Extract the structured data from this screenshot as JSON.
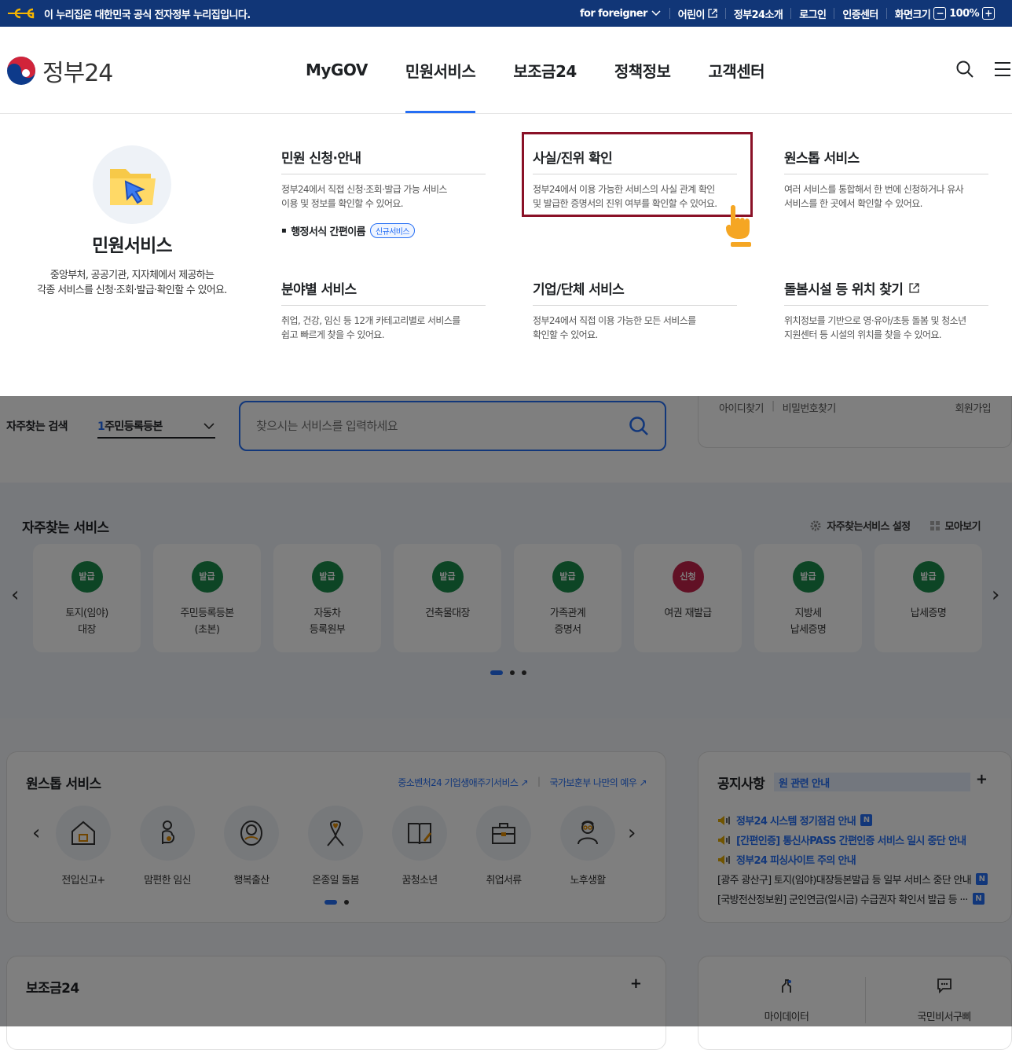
{
  "topbar": {
    "notice": "이 누리집은 대한민국 공식 전자정부 누리집입니다.",
    "links": {
      "foreigner": "for foreigner",
      "kids": "어린이",
      "about": "정부24소개",
      "login": "로그인",
      "cert": "인증센터",
      "screen_size": "화면크기",
      "zoom": "100%"
    }
  },
  "header": {
    "logo_text": "정부24",
    "nav": [
      "MyGOV",
      "민원서비스",
      "보조금24",
      "정책정보",
      "고객센터"
    ],
    "active_nav": "민원서비스"
  },
  "mega": {
    "intro_title": "민원서비스",
    "intro_desc_1": "중앙부처, 공공기관, 지자체에서 제공하는",
    "intro_desc_2": "각종 서비스를 신청·조회·발급·확인할 수 있어요.",
    "col1_title": "민원 신청·안내",
    "col1_desc_1": "정부24에서 직접 신청·조회·발급 가능 서비스",
    "col1_desc_2": "이용 및 정보를 확인할 수 있어요.",
    "col1_sub": "행정서식 간편이름",
    "col1_sub_badge": "신규서비스",
    "col2_title": "사실/진위 확인",
    "col2_desc_1": "정부24에서 이용 가능한 서비스의 사실 관계 확인",
    "col2_desc_2": "및 발급한 증명서의 진위 여부를 확인할 수 있어요.",
    "col3_title": "원스톱 서비스",
    "col3_desc_1": "여러 서비스를 통합해서 한 번에 신청하거나 유사",
    "col3_desc_2": "서비스를 한 곳에서 확인할 수 있어요.",
    "col4_title": "분야별 서비스",
    "col4_desc_1": "취업, 건강, 임신 등 12개 카테고리별로 서비스를",
    "col4_desc_2": "쉽고 빠르게 찾을 수 있어요.",
    "col5_title": "기업/단체 서비스",
    "col5_desc_1": "정부24에서 직접 이용 가능한 모든 서비스를",
    "col5_desc_2": "확인할 수 있어요.",
    "col6_title": "돌봄시설 등 위치 찾기",
    "col6_desc_1": "위치정보를 기반으로 영·유아/초등 돌봄 및 청소년",
    "col6_desc_2": "지원센터 등 시설의 위치를 찾을 수 있어요."
  },
  "search": {
    "label": "자주찾는 검색",
    "select_num": "1",
    "select_value": "주민등록등본",
    "placeholder": "찾으시는 서비스를 입력하세요"
  },
  "login_card": {
    "find_id": "아이디찾기",
    "find_pw": "비밀번호찾기",
    "signup": "회원가입"
  },
  "favorites": {
    "title": "자주찾는 서비스",
    "settings": "자주찾는서비스 설정",
    "view_all": "모아보기",
    "items": [
      {
        "tag": "발급",
        "name": "토지(임야)\n대장"
      },
      {
        "tag": "발급",
        "name": "주민등록등본\n(초본)"
      },
      {
        "tag": "발급",
        "name": "자동차\n등록원부"
      },
      {
        "tag": "발급",
        "name": "건축물대장"
      },
      {
        "tag": "발급",
        "name": "가족관계\n증명서"
      },
      {
        "tag": "신청",
        "name": "여권 재발급"
      },
      {
        "tag": "발급",
        "name": "지방세\n납세증명"
      },
      {
        "tag": "발급",
        "name": "납세증명"
      }
    ]
  },
  "onestop": {
    "title": "원스톱 서비스",
    "link1": "중소벤처24 기업생애주기서비스",
    "link2": "국가보훈부 나만의 예우",
    "items": [
      "전입신고+",
      "맘편한 임신",
      "행복출산",
      "온종일 돌봄",
      "꿈청소년",
      "취업서류",
      "노후생활"
    ]
  },
  "notice": {
    "title": "공지사항",
    "tag": "원 관련 안내",
    "items": [
      "정부24 시스템 정기점검 안내",
      "[간편인증] 통신사PASS 간편인증 서비스 일시 중단 안내",
      "정부24 피싱사이트 주의 안내",
      "[광주 광산구] 토지(임야)대장등본발급 등 일부 서비스 중단 안내",
      "[국방전산정보원] 군인연금(일시금) 수급권자 확인서 발급 등 ···"
    ]
  },
  "subsidy": {
    "title": "보조금24"
  },
  "quick": {
    "mydata": "마이데이터",
    "secretary": "국민비서구삐"
  },
  "colors": {
    "topbar_bg": "#113677",
    "accent_blue": "#256ef4",
    "highlight": "#8a1127",
    "issue_green": "#1b8a4a",
    "apply_red": "#c3224a"
  }
}
